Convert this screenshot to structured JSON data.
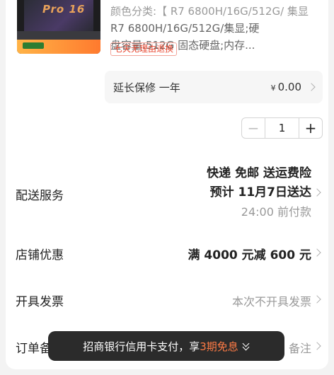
{
  "product": {
    "spec_line1": "颜色分类:【 R7 6800H/16G/512G/ 集显",
    "spec_line2": "R7 6800H/16G/512G/集显;硬",
    "spec_line3": "盘容量:512G 固态硬盘;内存...",
    "return_tag": "七天无理由退换",
    "image_text": "Pro 16"
  },
  "warranty": {
    "label": "延长保修 一年",
    "currency": "¥",
    "price": "0.00"
  },
  "quantity": {
    "minus": "−",
    "value": "1",
    "plus": "+"
  },
  "delivery": {
    "label": "配送服务",
    "line1": "快递 免邮 送运费险",
    "line2": "预计 11月7日送达",
    "line3": "24:00 前付款"
  },
  "shop_discount": {
    "label": "店铺优惠",
    "value": "满 4000 元减 600 元"
  },
  "invoice": {
    "label": "开具发票",
    "value": "本次不开具发票"
  },
  "order_note": {
    "label": "订单备注",
    "value": "备注"
  },
  "toast": {
    "prefix": "招商银行信用卡支付，享",
    "highlight": "3期免息"
  },
  "colors": {
    "accent": "#ff7b45",
    "tag_red": "#e8462f"
  }
}
